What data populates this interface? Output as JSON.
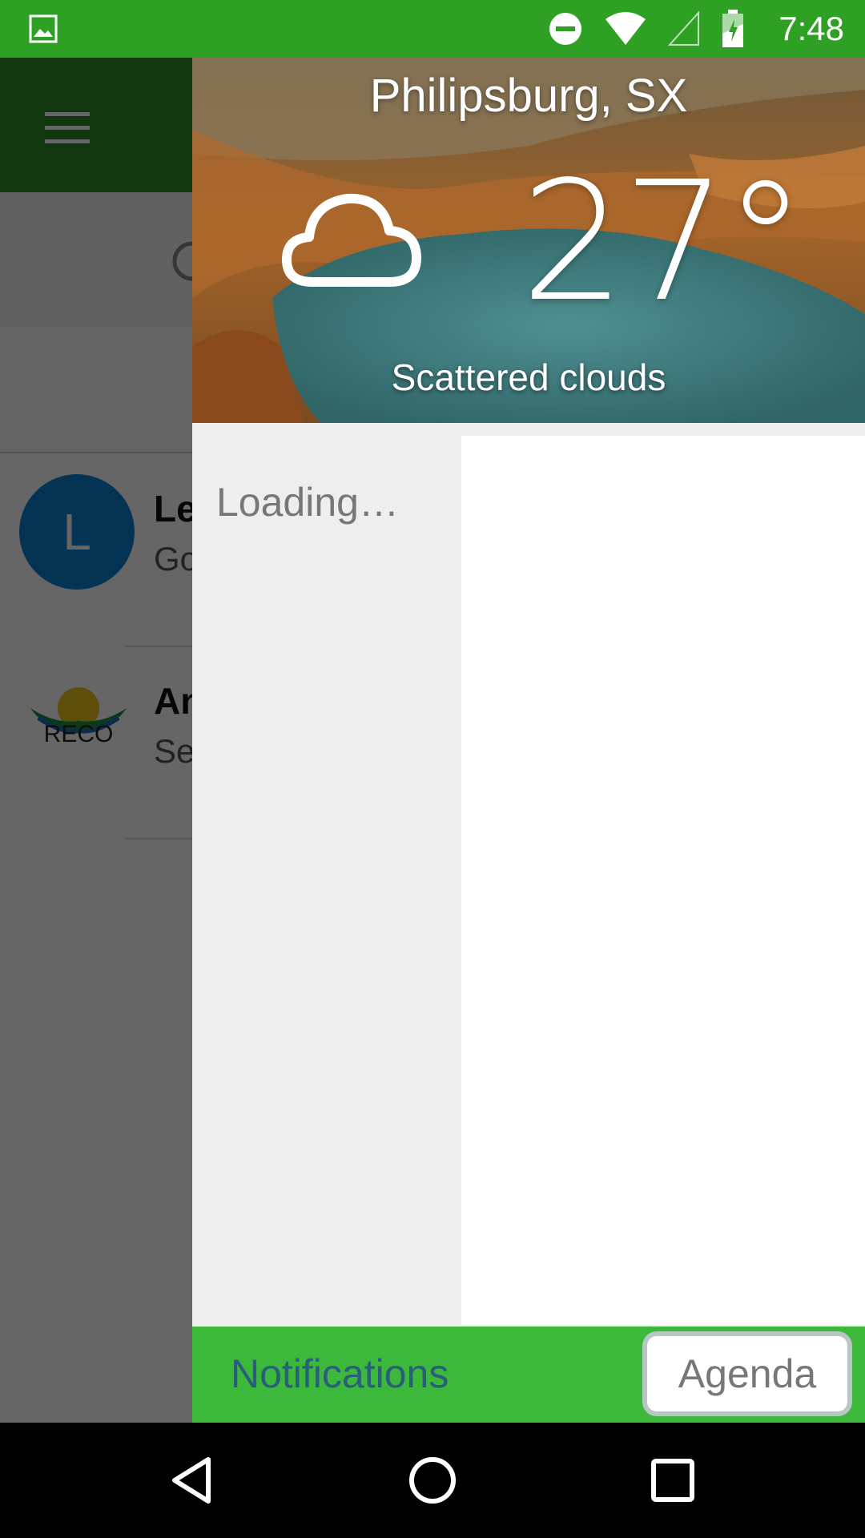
{
  "status_bar": {
    "time": "7:48",
    "icons": [
      "image-notification-icon",
      "dnd-icon",
      "wifi-icon",
      "signal-icon",
      "battery-charging-icon"
    ],
    "color": "#2ea124"
  },
  "background_app": {
    "toolbar_color": "#2b8a23",
    "list": [
      {
        "avatar_letter": "L",
        "title": "Le",
        "subtitle": "Go"
      },
      {
        "title": "An",
        "subtitle": "Se"
      }
    ]
  },
  "weather": {
    "city": "Philipsburg, SX",
    "temperature": "27°",
    "condition": "Scattered clouds",
    "icon": "cloud-icon"
  },
  "drawer": {
    "loading_text": "Loading…",
    "tabs": {
      "notifications": "Notifications",
      "agenda": "Agenda"
    },
    "accent": "#3cb93a"
  },
  "nav_bar": {
    "buttons": [
      "back-icon",
      "home-icon",
      "recents-icon"
    ]
  }
}
